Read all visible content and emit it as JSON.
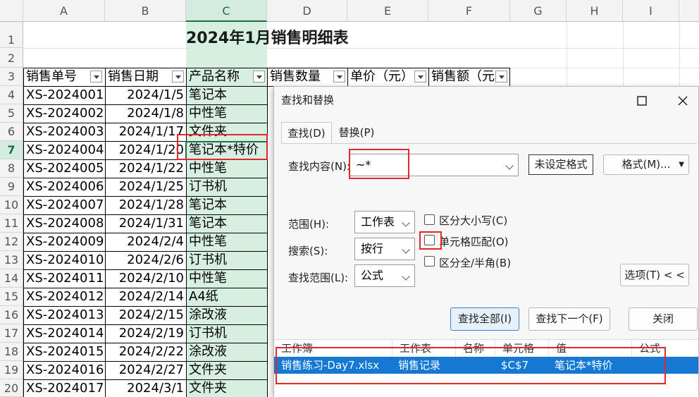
{
  "columns": [
    "A",
    "B",
    "C",
    "D",
    "E",
    "F",
    "G",
    "H",
    "I"
  ],
  "rows": [
    "1",
    "2",
    "3",
    "4",
    "5",
    "6",
    "7",
    "8",
    "9",
    "10",
    "11",
    "12",
    "13",
    "14",
    "15",
    "16",
    "17",
    "18",
    "19",
    "20"
  ],
  "sheet_title": "2024年1月销售明细表",
  "headers": [
    "销售单号",
    "销售日期",
    "产品名称",
    "销售数量",
    "单价（元）",
    "销售额（元"
  ],
  "data": [
    [
      "XS-2024001",
      "2024/1/5",
      "笔记本"
    ],
    [
      "XS-2024002",
      "2024/1/8",
      "中性笔"
    ],
    [
      "XS-2024003",
      "2024/1/17",
      "文件夹"
    ],
    [
      "XS-2024004",
      "2024/1/20",
      "笔记本*特价"
    ],
    [
      "XS-2024005",
      "2024/1/22",
      "中性笔"
    ],
    [
      "XS-2024006",
      "2024/1/25",
      "订书机"
    ],
    [
      "XS-2024007",
      "2024/1/28",
      "笔记本"
    ],
    [
      "XS-2024008",
      "2024/1/31",
      "笔记本"
    ],
    [
      "XS-2024009",
      "2024/2/4",
      "中性笔"
    ],
    [
      "XS-2024010",
      "2024/2/6",
      "订书机"
    ],
    [
      "XS-2024011",
      "2024/2/10",
      "中性笔"
    ],
    [
      "XS-2024012",
      "2024/2/14",
      "A4纸"
    ],
    [
      "XS-2024013",
      "2024/2/15",
      "涂改液"
    ],
    [
      "XS-2024014",
      "2024/2/19",
      "订书机"
    ],
    [
      "XS-2024015",
      "2024/2/22",
      "涂改液"
    ],
    [
      "XS-2024016",
      "2024/2/27",
      "文件夹"
    ],
    [
      "XS-2024017",
      "2024/3/1",
      "文件夹"
    ]
  ],
  "dialog": {
    "title": "查找和替换",
    "tab_find": "查找(D)",
    "tab_replace": "替换(P)",
    "find_label": "查找内容(N):",
    "find_value": "~*",
    "no_format": "未设定格式",
    "format_btn": "格式(M)...",
    "scope_label": "范围(H):",
    "scope_value": "工作表",
    "search_label": "搜索(S):",
    "search_value": "按行",
    "lookin_label": "查找范围(L):",
    "lookin_value": "公式",
    "match_case": "区分大小写(C)",
    "match_cell": "单元格匹配(O)",
    "match_width": "区分全/半角(B)",
    "options_btn": "选项(T) < <",
    "find_all": "查找全部(I)",
    "find_next": "查找下一个(F)",
    "close": "关闭",
    "results_headers": [
      "工作簿",
      "工作表",
      "名称",
      "单元格",
      "值",
      "公式"
    ],
    "result": {
      "workbook": "销售练习-Day7.xlsx",
      "sheet": "销售记录",
      "name": "",
      "cell": "$C$7",
      "value": "笔记本*特价",
      "formula": ""
    }
  },
  "colors": {
    "selected_column": "#d6efe0",
    "accent_green": "#1e7145",
    "highlight_red": "#e0282e",
    "result_blue": "#1579d4"
  }
}
